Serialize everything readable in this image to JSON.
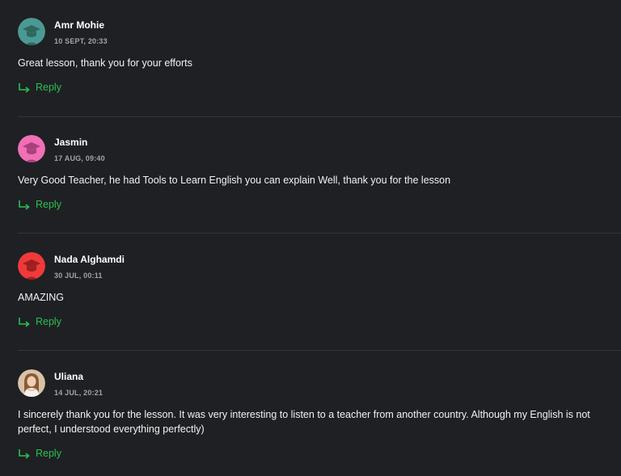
{
  "colors": {
    "background": "#1f2023",
    "reply_accent": "#27c152",
    "date_text": "#a3a3a3",
    "divider": "#34353a"
  },
  "comments": [
    {
      "author": "Amr Mohie",
      "date": "10 SEPT, 20:33",
      "text": "Great lesson, thank you for your efforts",
      "reply_label": "Reply",
      "avatar_icon": "graduation-cap-icon",
      "avatar_color": "#4a9a93"
    },
    {
      "author": "Jasmin",
      "date": "17 AUG, 09:40",
      "text": "Very Good Teacher, he had Tools to Learn English you can explain Well, thank you for the lesson",
      "reply_label": "Reply",
      "avatar_icon": "graduation-cap-icon",
      "avatar_color": "#f06fb6"
    },
    {
      "author": "Nada Alghamdi",
      "date": "30 JUL, 00:11",
      "text": "AMAZING",
      "reply_label": "Reply",
      "avatar_icon": "graduation-cap-icon",
      "avatar_color": "#ee3a3a"
    },
    {
      "author": "Uliana",
      "date": "14 JUL, 20:21",
      "text": "I sincerely thank you for the lesson. It was very interesting to listen to a teacher from another country. Although my English is not perfect, I understood everything perfectly)",
      "reply_label": "Reply",
      "avatar_icon": "user-photo",
      "avatar_color": "#c9a07a"
    }
  ]
}
